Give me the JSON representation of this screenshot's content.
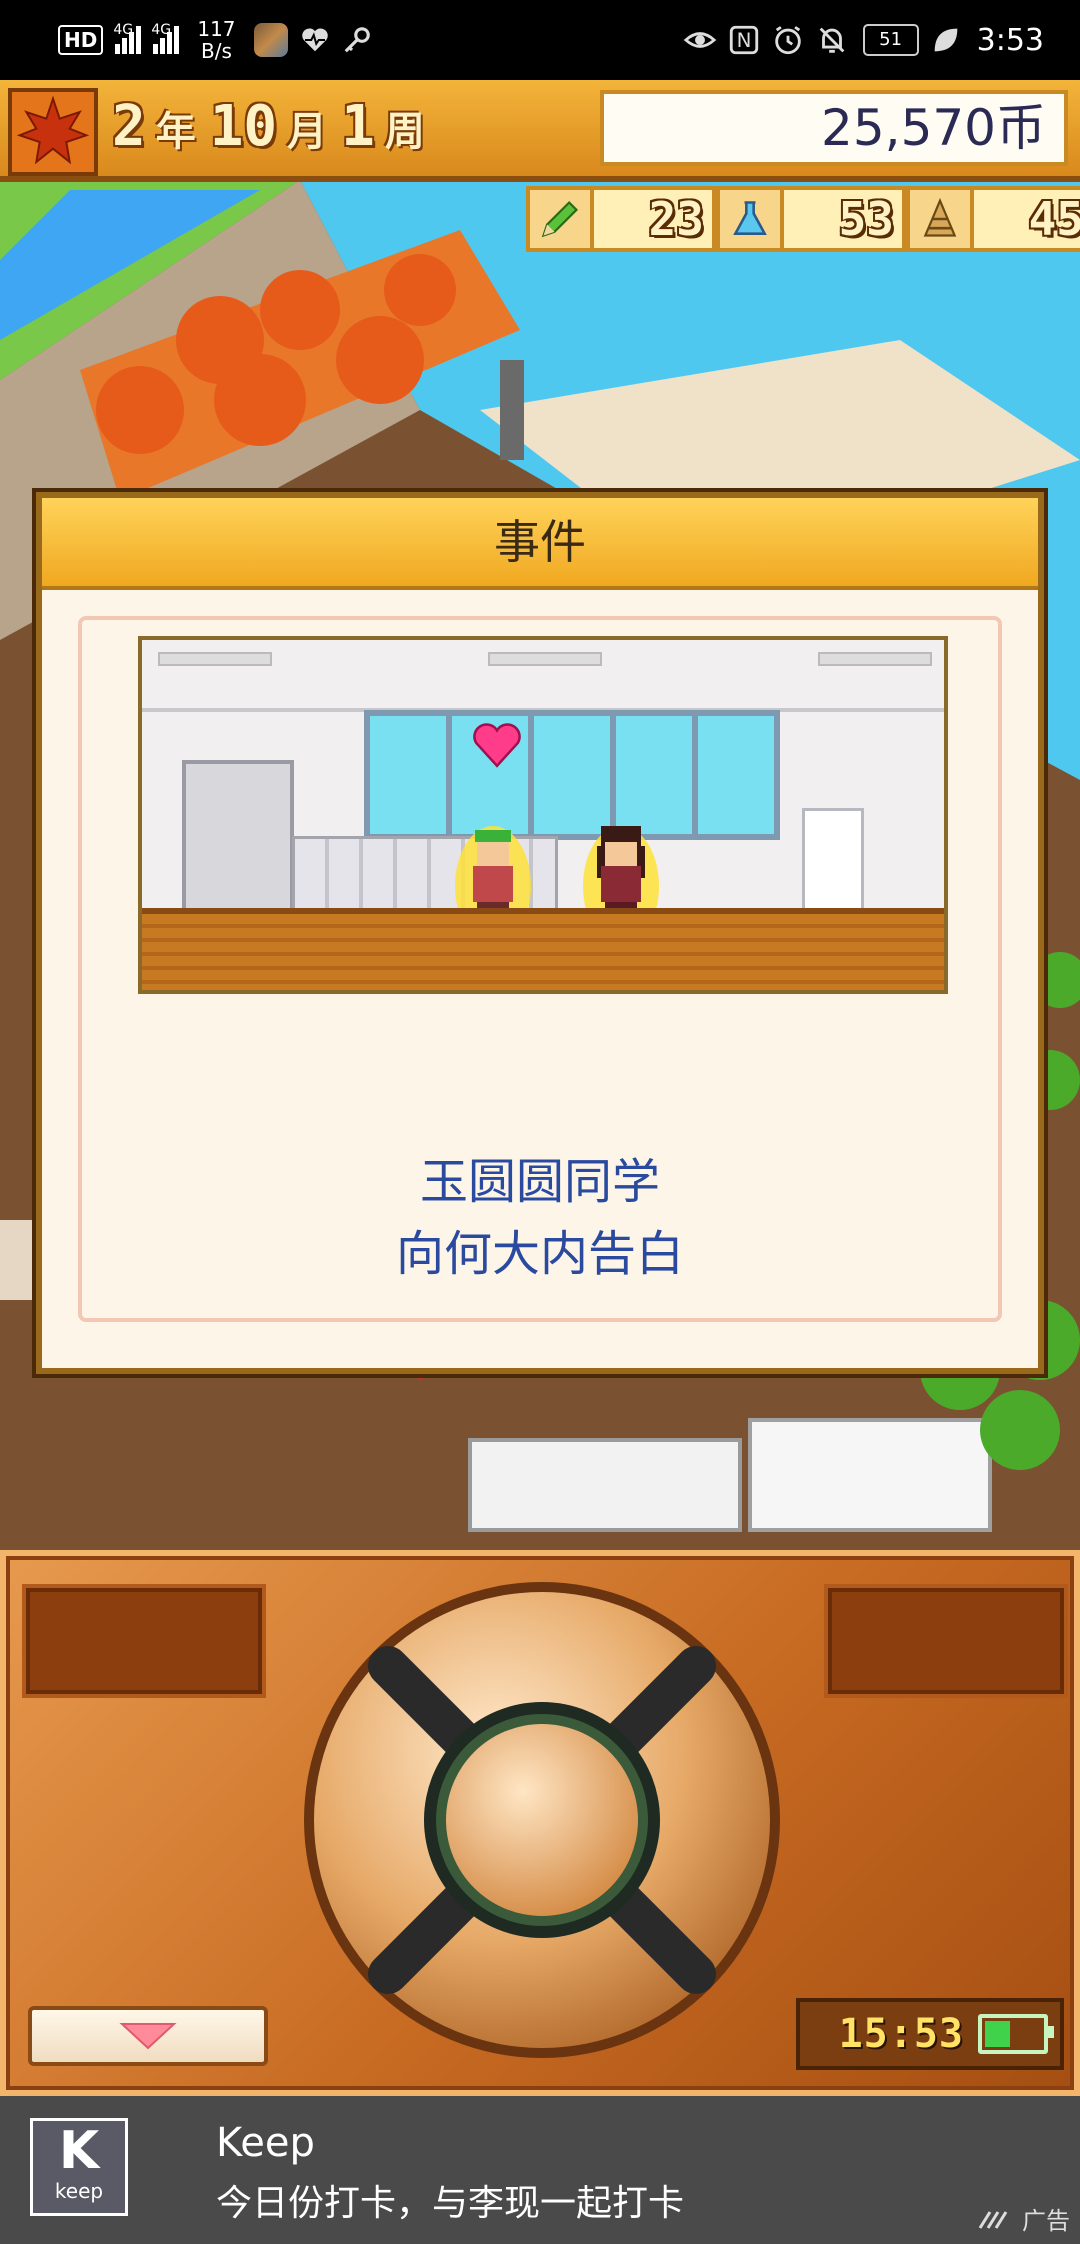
{
  "status_bar": {
    "hd": "HD",
    "net1": "4G",
    "net2": "4G",
    "speed_value": "117",
    "speed_unit": "B/s",
    "nfc": "N",
    "battery": "51",
    "time": "3:53"
  },
  "hud": {
    "year": "2",
    "year_unit": "年",
    "month": "10",
    "month_unit": "月",
    "week": "1",
    "week_unit": "周",
    "money": "25,570币",
    "stats": [
      {
        "icon": "pencil-icon",
        "value": "23"
      },
      {
        "icon": "flask-icon",
        "value": "53"
      },
      {
        "icon": "cone-icon",
        "value": "45"
      }
    ]
  },
  "event": {
    "title": "事件",
    "line1": "玉圆圆同学",
    "line2": "向何大内告白"
  },
  "controller": {
    "clock": "15:53",
    "battery_level": 0.45
  },
  "ad": {
    "logo_letter": "K",
    "logo_word": "keep",
    "title": "Keep",
    "description": "今日份打卡，与李现一起打卡",
    "tag": "广告"
  },
  "colors": {
    "hud_gold": "#f3b43a",
    "dialog_text": "#2a4aa0",
    "controller_orange": "#c76a22",
    "ad_bg": "#4a4a4a"
  }
}
